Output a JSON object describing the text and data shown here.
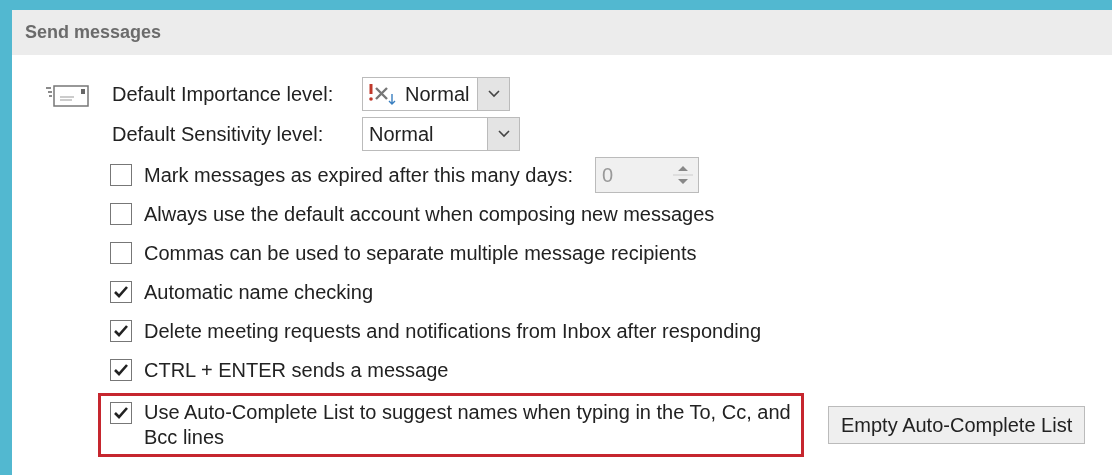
{
  "section": {
    "title": "Send messages"
  },
  "importance": {
    "label": "Default Importance level:",
    "value": "Normal"
  },
  "sensitivity": {
    "label": "Default Sensitivity level:",
    "value": "Normal"
  },
  "options": [
    {
      "label": "Mark messages as expired after this many days:",
      "checked": false,
      "highlighted": false,
      "spinner": {
        "value": "0",
        "disabled": true
      }
    },
    {
      "label": "Always use the default account when composing new messages",
      "checked": false,
      "highlighted": false
    },
    {
      "label": "Commas can be used to separate multiple message recipients",
      "checked": false,
      "highlighted": false
    },
    {
      "label": "Automatic name checking",
      "checked": true,
      "highlighted": false
    },
    {
      "label": "Delete meeting requests and notifications from Inbox after responding",
      "checked": true,
      "highlighted": false
    },
    {
      "label": "CTRL + ENTER sends a message",
      "checked": true,
      "highlighted": false
    },
    {
      "label": "Use Auto-Complete List to suggest names when typing in the To, Cc, and Bcc lines",
      "checked": true,
      "highlighted": true,
      "button": "Empty Auto-Complete List"
    }
  ]
}
